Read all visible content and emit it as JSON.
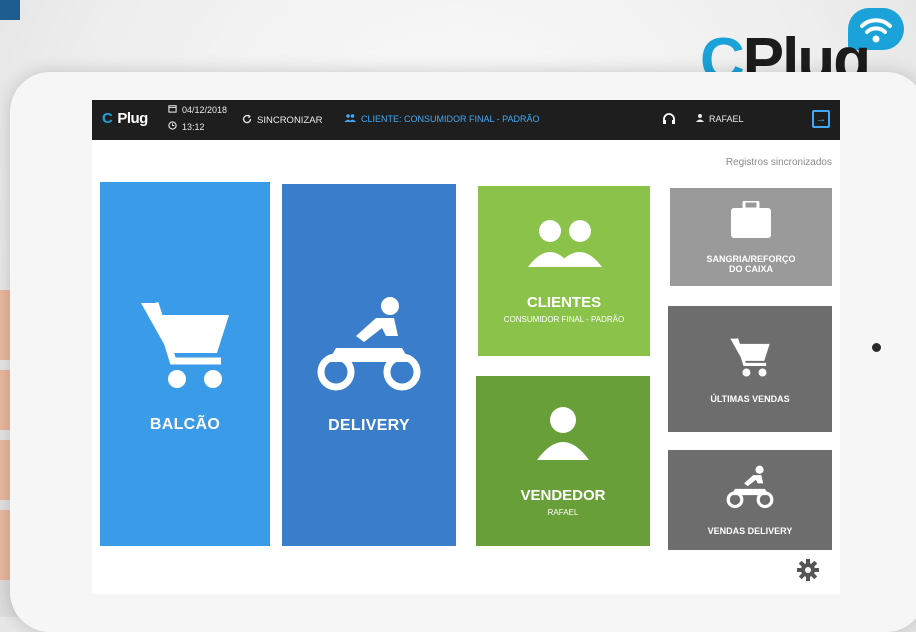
{
  "brand": {
    "logo_text_c": "C",
    "logo_text_rest": "Plug"
  },
  "topbar": {
    "logo_text_c": "C",
    "logo_text_rest": "Plug",
    "date": "04/12/2018",
    "time": "13:12",
    "sync_label": "SINCRONIZAR",
    "client_label": "CLIENTE: CONSUMIDOR FINAL - PADRÃO",
    "user_label": "RAFAEL"
  },
  "status": {
    "sync_message": "Registros sincronizados"
  },
  "tiles": {
    "balcao": {
      "title": "BALCÃO",
      "icon": "cart-icon"
    },
    "delivery": {
      "title": "DELIVERY",
      "icon": "motorcycle-icon"
    },
    "clientes": {
      "title": "CLIENTES",
      "subtitle": "CONSUMIDOR FINAL - PADRÃO",
      "icon": "users-icon"
    },
    "vendedor": {
      "title": "VENDEDOR",
      "subtitle": "RAFAEL",
      "icon": "user-icon"
    },
    "sangria": {
      "title_line1": "SANGRIA/REFORÇO",
      "title_line2": "DO CAIXA",
      "icon": "briefcase-icon"
    },
    "ultimas": {
      "title": "ÚLTIMAS VENDAS",
      "icon": "cart-icon"
    },
    "vendas_delivery": {
      "title": "VENDAS DELIVERY",
      "icon": "motorcycle-icon"
    }
  },
  "colors": {
    "balcao": "#3a9be8",
    "delivery": "#3a7dcb",
    "clientes": "#8bc24a",
    "vendedor": "#689f38",
    "sangria": "#9a9a9a",
    "dark_tile": "#6d6d6d",
    "accent": "#1ba3d9",
    "topbar": "#1e1e1e"
  }
}
